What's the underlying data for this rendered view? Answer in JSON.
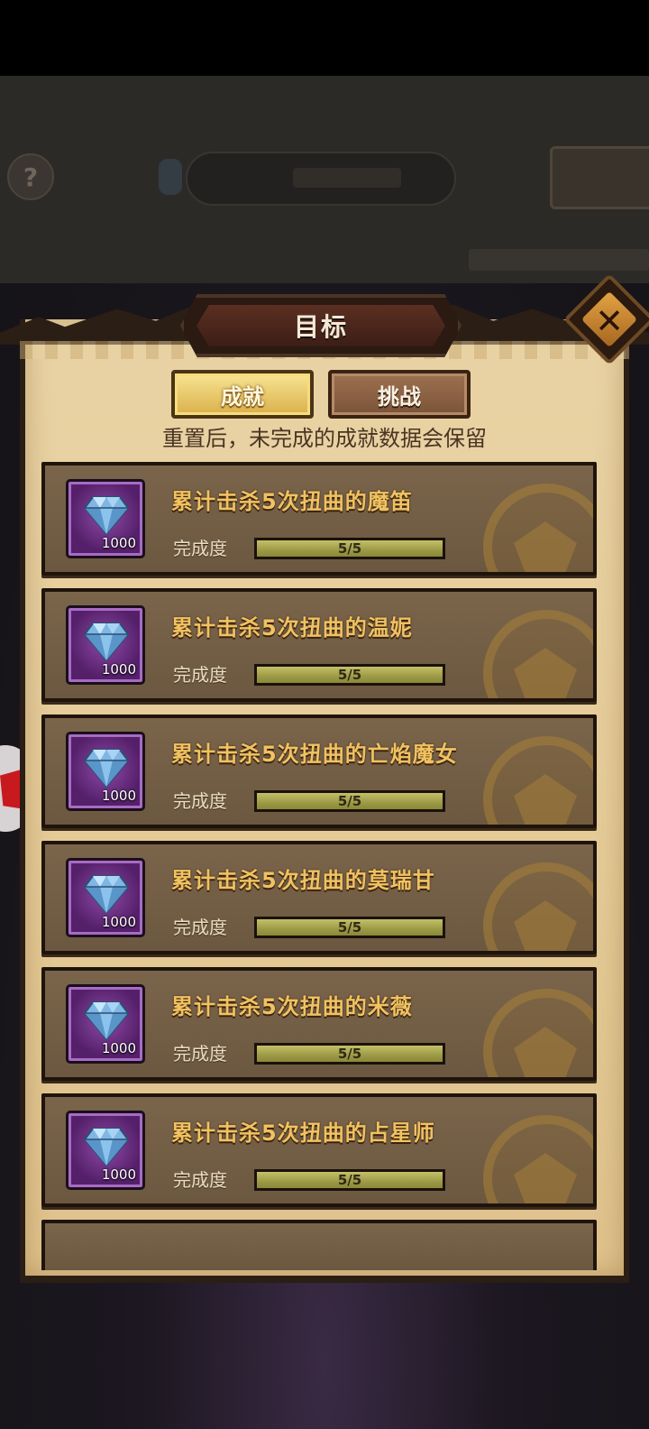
{
  "dialog": {
    "title": "目标",
    "close_icon": "close-icon"
  },
  "tabs": [
    {
      "label": "成就",
      "active": true
    },
    {
      "label": "挑战",
      "active": false
    }
  ],
  "notice": "重置后，未完成的成就数据会保留",
  "progress_label": "完成度",
  "achievements": [
    {
      "title": "累计击杀5次扭曲的魔笛",
      "reward_icon": "diamond-icon",
      "reward_count": "1000",
      "progress_text": "5/5",
      "progress_fraction": 1.0
    },
    {
      "title": "累计击杀5次扭曲的温妮",
      "reward_icon": "diamond-icon",
      "reward_count": "1000",
      "progress_text": "5/5",
      "progress_fraction": 1.0
    },
    {
      "title": "累计击杀5次扭曲的亡焰魔女",
      "reward_icon": "diamond-icon",
      "reward_count": "1000",
      "progress_text": "5/5",
      "progress_fraction": 1.0
    },
    {
      "title": "累计击杀5次扭曲的莫瑞甘",
      "reward_icon": "diamond-icon",
      "reward_count": "1000",
      "progress_text": "5/5",
      "progress_fraction": 1.0
    },
    {
      "title": "累计击杀5次扭曲的米薇",
      "reward_icon": "diamond-icon",
      "reward_count": "1000",
      "progress_text": "5/5",
      "progress_fraction": 1.0
    },
    {
      "title": "累计击杀5次扭曲的占星师",
      "reward_icon": "diamond-icon",
      "reward_count": "1000",
      "progress_text": "5/5",
      "progress_fraction": 1.0
    }
  ],
  "colors": {
    "title_gold": "#f1c261",
    "tab_active": "#f0d67a",
    "tab_inactive": "#8a6245",
    "panel_parchment": "#e7d0a0",
    "row_bg": "#735f46"
  }
}
